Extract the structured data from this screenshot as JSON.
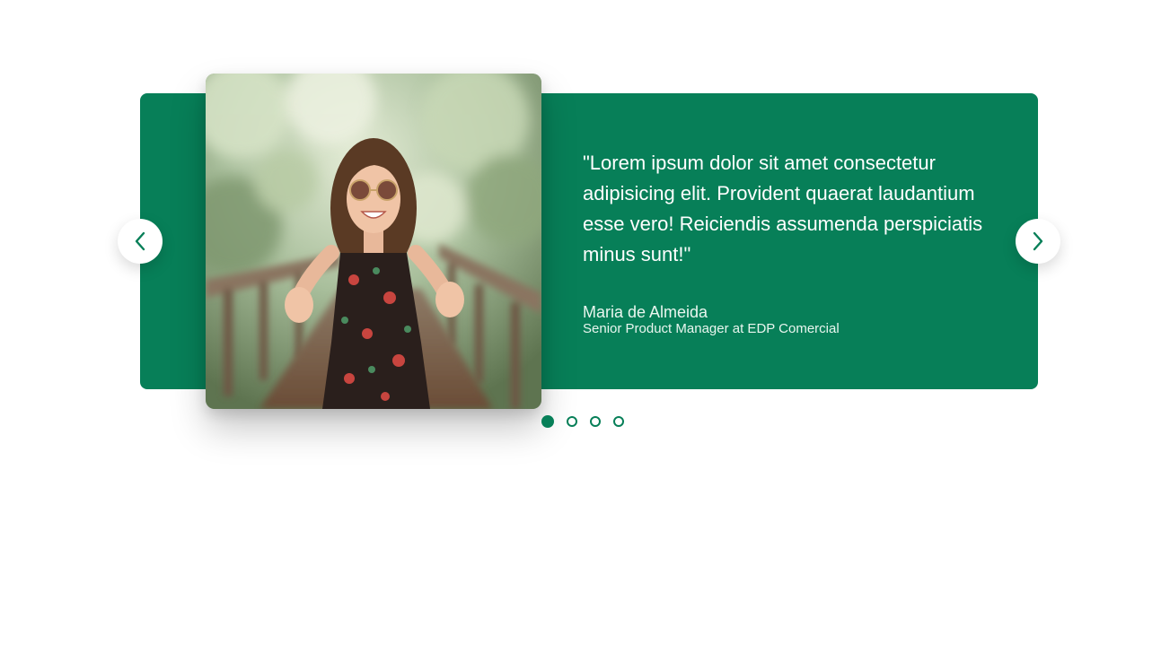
{
  "testimonial": {
    "quote": "\"Lorem ipsum dolor sit amet consectetur adipisicing elit. Provident quaerat laudantium esse vero! Reiciendis assumenda perspiciatis minus sunt!\"",
    "author_name": "Maria de Almeida",
    "author_role": "Senior Product Manager at EDP Comercial",
    "photo_alt": "Maria de Almeida"
  },
  "navigation": {
    "prev_icon": "chevron-left-icon",
    "next_icon": "chevron-right-icon",
    "total_slides": 4,
    "active_slide": 1
  },
  "colors": {
    "brand": "#077f58",
    "background": "#ffffff",
    "text_on_brand": "#ffffff"
  }
}
